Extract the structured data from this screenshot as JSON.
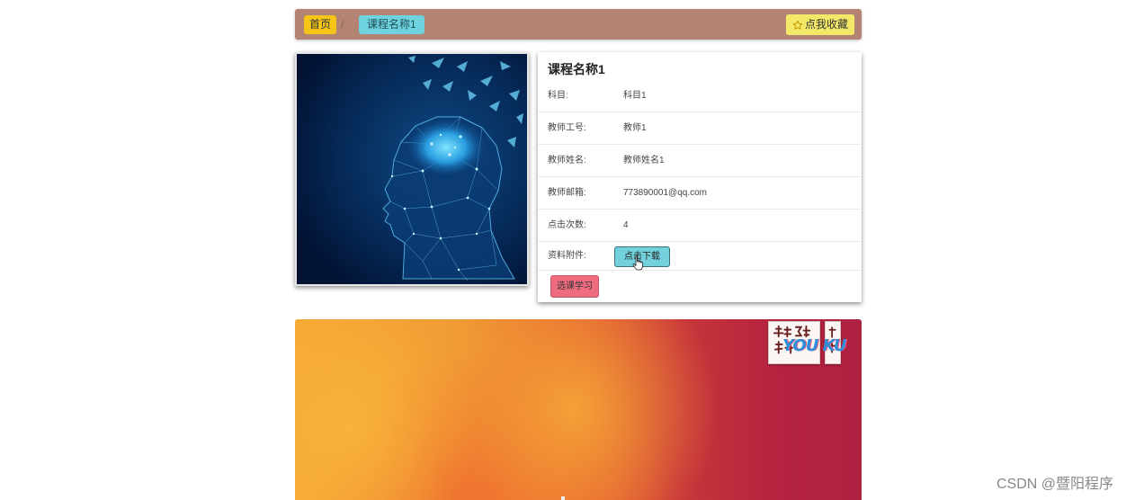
{
  "breadcrumb": {
    "home": "首页",
    "separator": "/",
    "current": "课程名称1"
  },
  "favorite": {
    "label": "点我收藏",
    "icon": "star-outline-icon",
    "color": "#f3e868"
  },
  "course": {
    "title": "课程名称1",
    "image_icon": "ai-brain-head-image",
    "fields": [
      {
        "label": "科目:",
        "value": "科目1"
      },
      {
        "label": "教师工号:",
        "value": "教师1"
      },
      {
        "label": "教师姓名:",
        "value": "教师姓名1"
      },
      {
        "label": "教师邮箱:",
        "value": "773890001@qq.com"
      },
      {
        "label": "点击次数:",
        "value": "4"
      }
    ],
    "attachment": {
      "label": "资料附件:",
      "button": "点击下载"
    },
    "enroll_button": "选课学习"
  },
  "colors": {
    "topbar": "#b38373",
    "home_crumb": "#f5c518",
    "current_crumb": "#6fd3df",
    "download_button": "#72d1dd",
    "enroll_button": "#ef6c80"
  },
  "banner": {
    "logo": "YOU KU",
    "logo_icon": "video-tutorial-logo"
  },
  "watermark": "CSDN @暨阳程序"
}
